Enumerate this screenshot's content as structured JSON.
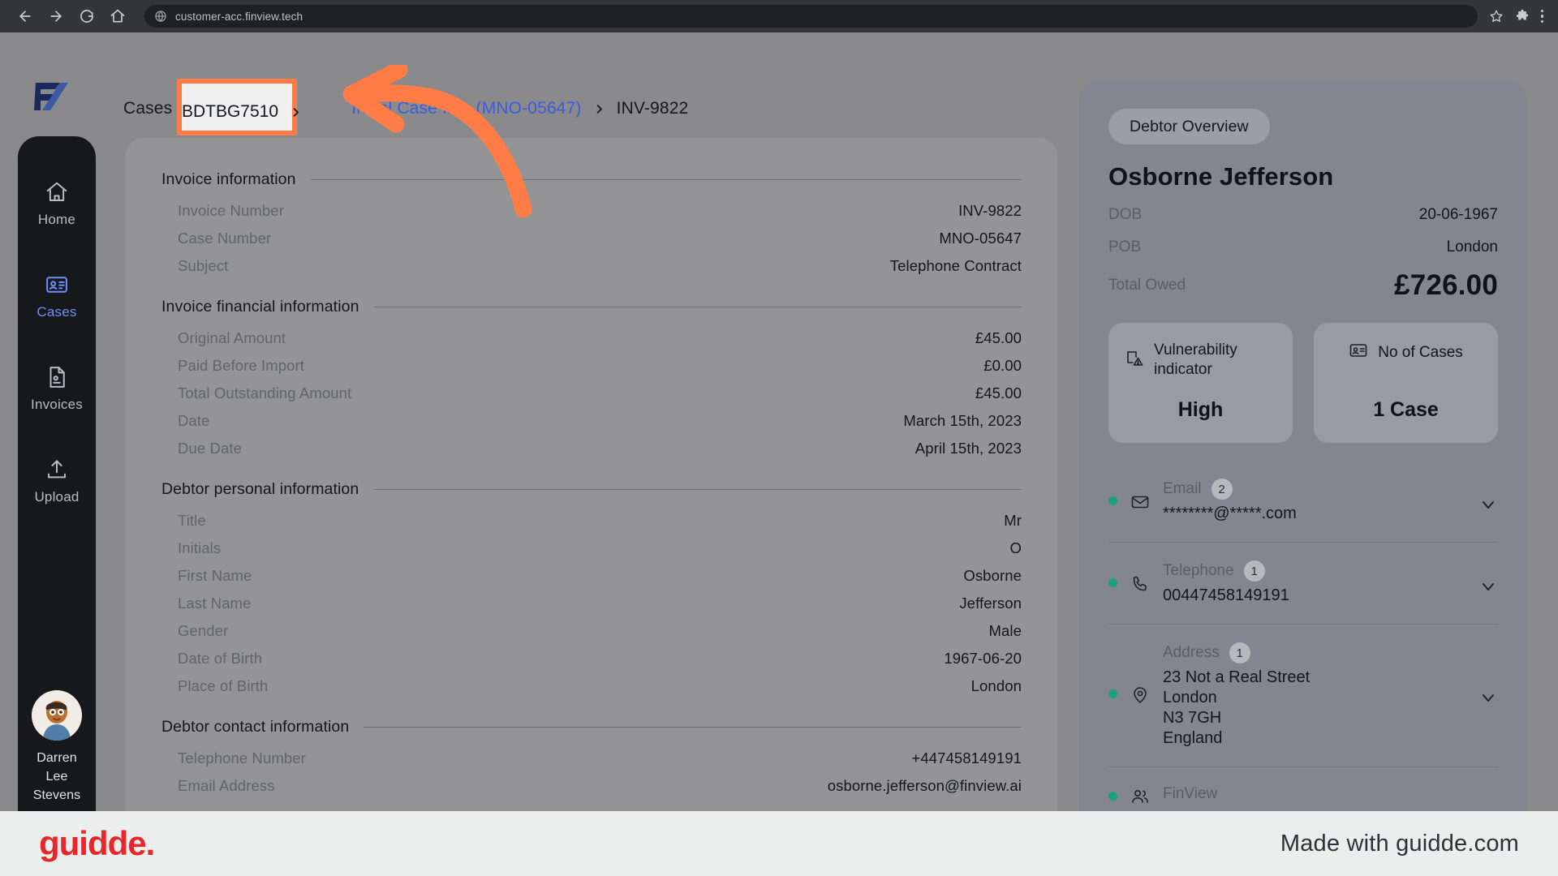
{
  "browser": {
    "url": "customer-acc.finview.tech",
    "back_icon": "back-arrow-icon",
    "forward_icon": "forward-arrow-icon",
    "reload_icon": "reload-icon",
    "home_icon": "home-icon",
    "site_icon": "globe-icon",
    "bookmark_icon": "star-icon",
    "extensions_icon": "puzzle-icon",
    "menu_icon": "kebab-menu-icon"
  },
  "sidebar": {
    "items": [
      {
        "label": "Home",
        "icon": "home-icon",
        "active": false
      },
      {
        "label": "Cases",
        "icon": "id-card-icon",
        "active": true
      },
      {
        "label": "Invoices",
        "icon": "document-icon",
        "active": false
      },
      {
        "label": "Upload",
        "icon": "upload-icon",
        "active": false
      }
    ],
    "profile": {
      "name_line1": "Darren",
      "name_line2": "Lee",
      "name_line3": "Stevens"
    }
  },
  "breadcrumb": {
    "root": "Cases",
    "highlighted": "BDTBG7510",
    "case_link": "Initial Case Info (MNO-05647)",
    "current": "INV-9822",
    "separator": "chevron-right-icon",
    "highlight_color": "#ff7c46"
  },
  "main": {
    "sections": [
      {
        "title": "Invoice information",
        "rows": [
          {
            "label": "Invoice Number",
            "value": "INV-9822"
          },
          {
            "label": "Case Number",
            "value": "MNO-05647"
          },
          {
            "label": "Subject",
            "value": "Telephone Contract"
          }
        ]
      },
      {
        "title": "Invoice financial information",
        "rows": [
          {
            "label": "Original Amount",
            "value": "£45.00"
          },
          {
            "label": "Paid Before Import",
            "value": "£0.00"
          },
          {
            "label": "Total Outstanding Amount",
            "value": "£45.00"
          },
          {
            "label": "Date",
            "value": "March 15th, 2023"
          },
          {
            "label": "Due Date",
            "value": "April 15th, 2023"
          }
        ]
      },
      {
        "title": "Debtor personal information",
        "rows": [
          {
            "label": "Title",
            "value": "Mr"
          },
          {
            "label": "Initials",
            "value": "O"
          },
          {
            "label": "First Name",
            "value": "Osborne"
          },
          {
            "label": "Last Name",
            "value": "Jefferson"
          },
          {
            "label": "Gender",
            "value": "Male"
          },
          {
            "label": "Date of Birth",
            "value": "1967-06-20"
          },
          {
            "label": "Place of Birth",
            "value": "London"
          }
        ]
      },
      {
        "title": "Debtor contact information",
        "rows": [
          {
            "label": "Telephone Number",
            "value": "+447458149191"
          },
          {
            "label": "Email Address",
            "value": "osborne.jefferson@finview.ai"
          }
        ]
      }
    ]
  },
  "debtor_panel": {
    "tab_label": "Debtor Overview",
    "name": "Osborne Jefferson",
    "dob_label": "DOB",
    "dob_value": "20-06-1967",
    "pob_label": "POB",
    "pob_value": "London",
    "total_owed_label": "Total Owed",
    "total_owed_value": "£726.00",
    "stat_cards": [
      {
        "title": "Vulnerability indicator",
        "value": "High",
        "icon": "vulnerability-icon"
      },
      {
        "title": "No of Cases",
        "value": "1 Case",
        "icon": "id-card-icon"
      }
    ],
    "contacts": [
      {
        "label": "Email",
        "count": "2",
        "value": "********@*****.com",
        "icon": "envelope-icon",
        "status": "active"
      },
      {
        "label": "Telephone",
        "count": "1",
        "value": "00447458149191",
        "icon": "phone-icon",
        "status": "active"
      },
      {
        "label": "Address",
        "count": "1",
        "value": "23 Not a Real Street\nLondon\nN3 7GH\nEngland",
        "icon": "location-pin-icon",
        "status": "active"
      },
      {
        "label": "FinView",
        "count": "",
        "value": "",
        "icon": "people-icon",
        "status": "active"
      }
    ],
    "expand_icon": "chevron-down-icon"
  },
  "footer": {
    "logo_text": "guidde.",
    "made_with": "Made with guidde.com",
    "logo_color": "#e8272c"
  }
}
